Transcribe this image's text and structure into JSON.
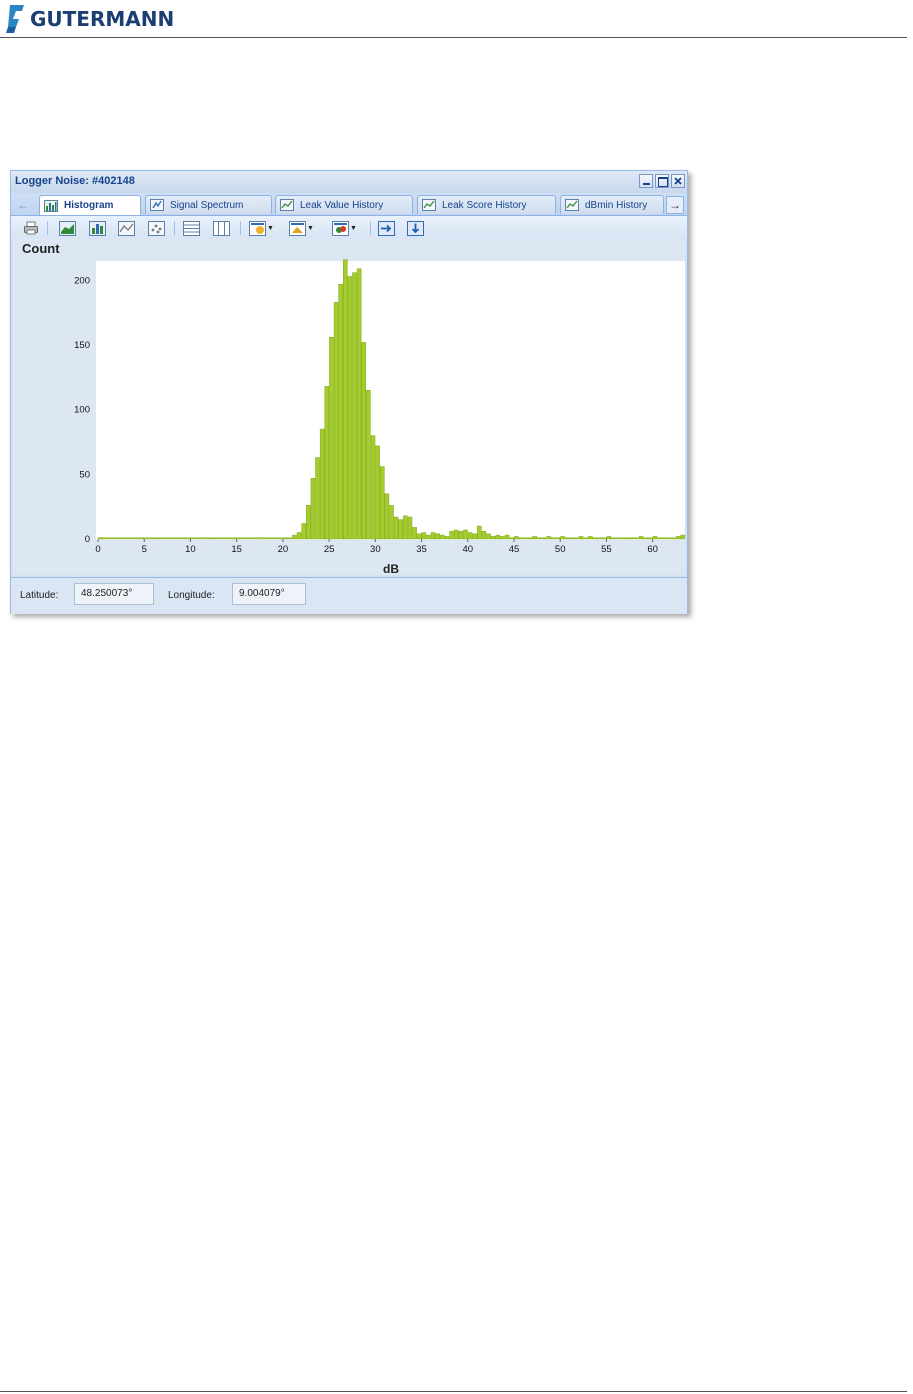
{
  "document": {
    "logo_text": "GUTERMANN"
  },
  "window": {
    "title": "Logger Noise: #402148"
  },
  "tabs": [
    {
      "label": "Histogram",
      "active": true
    },
    {
      "label": "Signal Spectrum",
      "active": false
    },
    {
      "label": "Leak Value History",
      "active": false
    },
    {
      "label": "Leak Score History",
      "active": false
    },
    {
      "label": "dBmin History",
      "active": false
    }
  ],
  "toolbar": {
    "icons": [
      "print-icon",
      "line-chart-icon",
      "bar-chart-icon",
      "area-chart-icon",
      "scatter-chart-icon",
      "horizontal-lines-icon",
      "vertical-lines-icon",
      "color-palette-icon",
      "chart-style-icon",
      "chart-options-icon",
      "export-icon",
      "import-icon"
    ]
  },
  "chart_data": {
    "type": "bar",
    "ylabel": "Count",
    "xlabel": "dB",
    "xlim": [
      0,
      63.5
    ],
    "ylim": [
      0,
      215
    ],
    "x_ticks": [
      0,
      5,
      10,
      15,
      20,
      25,
      30,
      35,
      40,
      45,
      50,
      55,
      60
    ],
    "y_ticks": [
      0,
      50,
      100,
      150,
      200
    ],
    "bin_width": 0.5,
    "color": "#a4cc2a",
    "edge_color": "#7fa81c",
    "x": [
      0,
      0.5,
      1,
      1.5,
      2,
      2.5,
      3,
      3.5,
      4,
      4.5,
      5,
      5.5,
      6,
      6.5,
      7,
      7.5,
      8,
      8.5,
      9,
      9.5,
      10,
      10.5,
      11,
      11.5,
      12,
      12.5,
      13,
      13.5,
      14,
      14.5,
      15,
      15.5,
      16,
      16.5,
      17,
      17.5,
      18,
      18.5,
      19,
      19.5,
      20,
      20.5,
      21,
      21.5,
      22,
      22.5,
      23,
      23.5,
      24,
      24.5,
      25,
      25.5,
      26,
      26.5,
      27,
      27.5,
      28,
      28.5,
      29,
      29.5,
      30,
      30.5,
      31,
      31.5,
      32,
      32.5,
      33,
      33.5,
      34,
      34.5,
      35,
      35.5,
      36,
      36.5,
      37,
      37.5,
      38,
      38.5,
      39,
      39.5,
      40,
      40.5,
      41,
      41.5,
      42,
      42.5,
      43,
      43.5,
      44,
      44.5,
      45,
      45.5,
      46,
      46.5,
      47,
      47.5,
      48,
      48.5,
      49,
      49.5,
      50,
      50.5,
      51,
      51.5,
      52,
      52.5,
      53,
      53.5,
      54,
      54.5,
      55,
      55.5,
      56,
      56.5,
      57,
      57.5,
      58,
      58.5,
      59,
      59.5,
      60,
      60.5,
      61,
      61.5,
      62,
      62.5,
      63
    ],
    "values": [
      1,
      1,
      1,
      1,
      1,
      1,
      1,
      1,
      1,
      1,
      1,
      1,
      1,
      1,
      1,
      1,
      1,
      1,
      1,
      1,
      1,
      1,
      1,
      1,
      1,
      1,
      1,
      1,
      1,
      1,
      1,
      1,
      1,
      1,
      1,
      1,
      1,
      1,
      1,
      1,
      1,
      1,
      3,
      5,
      12,
      26,
      47,
      63,
      85,
      118,
      156,
      183,
      197,
      216,
      203,
      206,
      209,
      152,
      115,
      80,
      72,
      56,
      35,
      26,
      17,
      15,
      18,
      17,
      9,
      4,
      5,
      3,
      5,
      4,
      3,
      2,
      6,
      7,
      6,
      7,
      5,
      4,
      10,
      6,
      4,
      2,
      3,
      2,
      3,
      1,
      2,
      1,
      1,
      1,
      2,
      1,
      1,
      2,
      1,
      1,
      2,
      1,
      1,
      1,
      2,
      1,
      2,
      1,
      1,
      1,
      2,
      1,
      1,
      1,
      1,
      1,
      1,
      2,
      1,
      1,
      2,
      1,
      1,
      1,
      1,
      2,
      3,
      1,
      1,
      2,
      1,
      1,
      6
    ]
  },
  "status": {
    "latitude_label": "Latitude:",
    "latitude_value": "48.250073°",
    "longitude_label": "Longitude:",
    "longitude_value": "9.004079°"
  }
}
